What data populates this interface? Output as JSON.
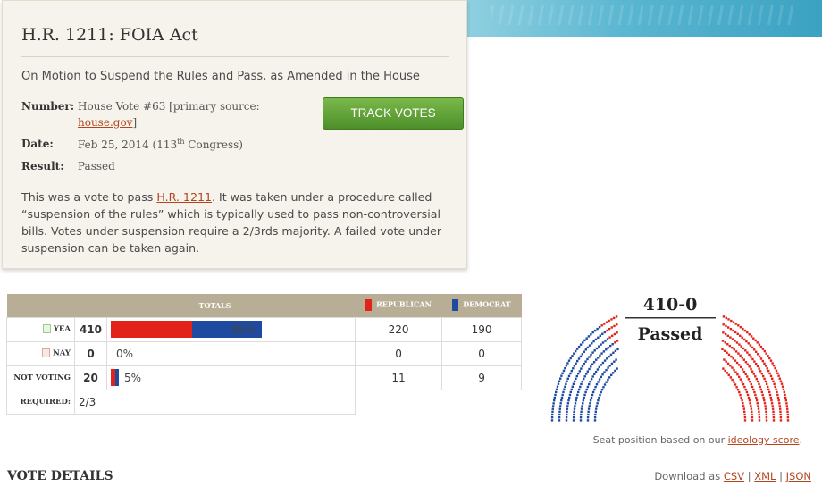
{
  "bill": {
    "title": "H.R. 1211: FOIA Act",
    "motion": "On Motion to Suspend the Rules and Pass, as Amended in the House"
  },
  "meta": {
    "number_label": "Number:",
    "number_value": "House Vote #63 [primary source:",
    "number_link": "house.gov",
    "number_close": "]",
    "date_label": "Date:",
    "date_value": "Feb 25, 2014 (113",
    "date_sup": "th",
    "date_tail": " Congress)",
    "result_label": "Result:",
    "result_value": "Passed"
  },
  "track_button": "TRACK VOTES",
  "description": {
    "before": "This was a vote to pass ",
    "link": "H.R. 1211",
    "after": ". It was taken under a procedure called “suspension of the rules” which is typically used to pass non-controversial bills. Votes under suspension require a 2/3rds majority. A failed vote under suspension can be taken again."
  },
  "totals": {
    "header": "TOTALS",
    "republican": "REPUBLICAN",
    "democrat": "DEMOCRAT",
    "colors": {
      "republican": "#e2231a",
      "democrat": "#1e4ba0"
    },
    "rows": [
      {
        "label": "YEA",
        "count": "410",
        "percent": "95%",
        "rep_fraction": 0.5366,
        "dem_fraction": 0.4634,
        "bar_fraction": 0.95,
        "rep": "220",
        "dem": "190"
      },
      {
        "label": "NAY",
        "count": "0",
        "percent": "0%",
        "rep_fraction": 0,
        "dem_fraction": 0,
        "bar_fraction": 0,
        "rep": "0",
        "dem": "0"
      },
      {
        "label": "NOT VOTING",
        "count": "20",
        "percent": "5%",
        "rep_fraction": 0.55,
        "dem_fraction": 0.45,
        "bar_fraction": 0.05,
        "rep": "11",
        "dem": "9"
      }
    ],
    "required_label": "REQUIRED:",
    "required_value": "2/3"
  },
  "chamber": {
    "score": "410-0",
    "result": "Passed",
    "rep_yea": 220,
    "dem_yea": 190,
    "rep_not_voting": 11,
    "dem_not_voting": 9
  },
  "footnote": {
    "text": "Seat position based on our ",
    "link": "ideology score",
    "end": "."
  },
  "vote_details": {
    "title": "VOTE DETAILS",
    "download_prefix": "Download as ",
    "csv": "CSV",
    "xml": "XML",
    "json": "JSON",
    "sep": " | "
  }
}
